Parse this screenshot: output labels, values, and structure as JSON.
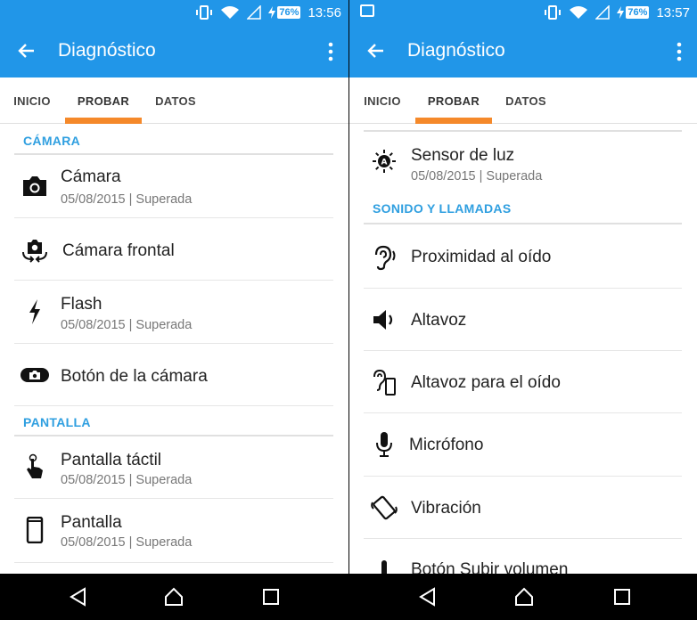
{
  "left": {
    "status": {
      "battery": "76%",
      "time": "13:56"
    },
    "appbar": {
      "title": "Diagnóstico"
    },
    "tabs": [
      "INICIO",
      "PROBAR",
      "DATOS"
    ],
    "sections": [
      {
        "title": "CÁMARA"
      },
      {
        "title": "PANTALLA"
      }
    ],
    "items": [
      {
        "label": "Cámara",
        "sub": "05/08/2015 | Superada",
        "icon": "camera-icon"
      },
      {
        "label": "Cámara frontal",
        "sub": "",
        "icon": "front-camera-icon"
      },
      {
        "label": "Flash",
        "sub": "05/08/2015 | Superada",
        "icon": "flash-icon"
      },
      {
        "label": "Botón de la cámara",
        "sub": "",
        "icon": "camera-button-icon"
      },
      {
        "label": "Pantalla táctil",
        "sub": "05/08/2015 | Superada",
        "icon": "touch-icon"
      },
      {
        "label": "Pantalla",
        "sub": "05/08/2015 | Superada",
        "icon": "screen-icon"
      }
    ]
  },
  "right": {
    "status": {
      "battery": "76%",
      "time": "13:57"
    },
    "appbar": {
      "title": "Diagnóstico"
    },
    "tabs": [
      "INICIO",
      "PROBAR",
      "DATOS"
    ],
    "sections": [
      {
        "title": "SONIDO Y LLAMADAS"
      }
    ],
    "items": [
      {
        "label": "Sensor de luz",
        "sub": "05/08/2015 | Superada",
        "icon": "light-sensor-icon"
      },
      {
        "label": "Proximidad al oído",
        "sub": "",
        "icon": "ear-icon"
      },
      {
        "label": "Altavoz",
        "sub": "",
        "icon": "speaker-icon"
      },
      {
        "label": "Altavoz para el oído",
        "sub": "",
        "icon": "earpiece-icon"
      },
      {
        "label": "Micrófono",
        "sub": "",
        "icon": "microphone-icon"
      },
      {
        "label": "Vibración",
        "sub": "",
        "icon": "vibration-icon"
      },
      {
        "label": "Botón Subir volumen",
        "sub": "",
        "icon": "volume-up-icon"
      }
    ]
  },
  "colors": {
    "accent": "#2196e8",
    "tab_indicator": "#f5892a",
    "section_text": "#2f9fe0"
  }
}
